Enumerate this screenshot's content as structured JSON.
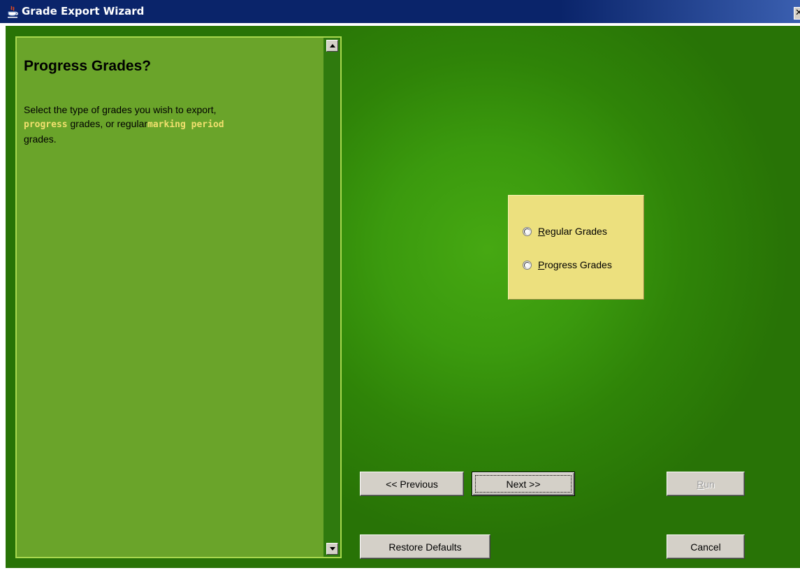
{
  "window": {
    "title": "Grade Export Wizard",
    "close_glyph": "✕"
  },
  "description": {
    "heading": "Progress Grades?",
    "text_part1": "Select the type of grades you wish to export,",
    "highlight1": "progress",
    "text_part2": " grades, or regular",
    "highlight2": "marking period",
    "text_part3": "grades."
  },
  "options": {
    "regular_accesskey": "R",
    "regular_rest": "egular Grades",
    "progress_accesskey": "P",
    "progress_rest": "rogress Grades"
  },
  "buttons": {
    "previous": "<< Previous",
    "next": "Next >>",
    "run_accesskey": "R",
    "run_rest": "un",
    "restore_defaults": "Restore Defaults",
    "cancel": "Cancel"
  },
  "colors": {
    "titlebar": "#0a246a",
    "background_green": "#3b9a0e",
    "panel_green": "#6aa42a",
    "panel_border": "#a8d84e",
    "highlight_text": "#f0e06e",
    "options_box": "#ece07e",
    "button_face": "#d4d0c8"
  },
  "icons": {
    "app": "java-cup-icon",
    "close": "close-icon",
    "scroll_up": "arrow-up-icon",
    "scroll_down": "arrow-down-icon"
  }
}
